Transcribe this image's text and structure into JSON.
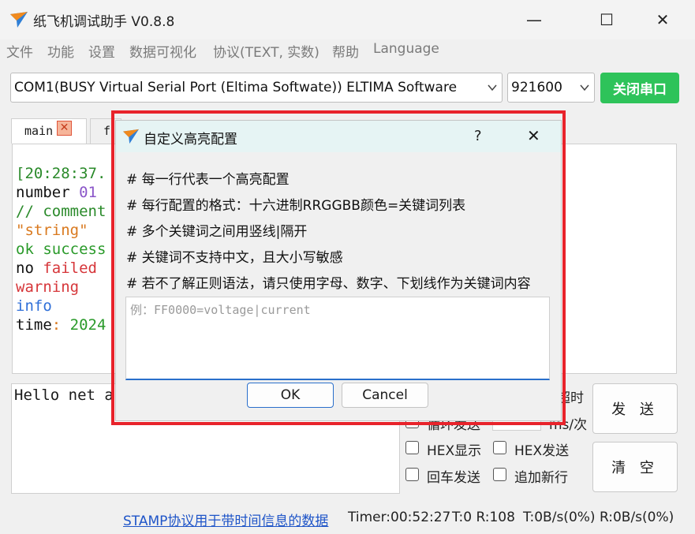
{
  "window": {
    "title": "纸飞机调试助手 V0.8.8",
    "minimize": "—",
    "maximize": "☐",
    "close": "✕"
  },
  "menu": [
    "文件",
    "功能",
    "设置",
    "数据可视化",
    "协议(TEXT, 实数)",
    "帮助",
    "Language"
  ],
  "port": {
    "selected": "COM1(BUSY  Virtual Serial Port (Eltima Softwate)) ELTIMA Software",
    "baud": "921600",
    "toggle_label": "关闭串口"
  },
  "tabs": [
    {
      "label": "main",
      "close": "✕"
    },
    {
      "label": "f"
    }
  ],
  "log": [
    {
      "text": "[20:28:37.",
      "color": "#2a8a2a"
    },
    {
      "parts": [
        {
          "text": "number ",
          "color": "#111111"
        },
        {
          "text": "01",
          "color": "#8a55c8"
        }
      ]
    },
    {
      "text": "// comment",
      "color": "#2a8a2a"
    },
    {
      "text": "\"string\"",
      "color": "#d9791e"
    },
    {
      "text": "ok success",
      "color": "#2a9a2a"
    },
    {
      "parts": [
        {
          "text": "no ",
          "color": "#111111"
        },
        {
          "text": "failed",
          "color": "#d6363a"
        }
      ]
    },
    {
      "text": "warning",
      "color": "#d6363a"
    },
    {
      "text": "info",
      "color": "#2f6fd8"
    },
    {
      "parts": [
        {
          "text": "time",
          "color": "#111111"
        },
        {
          "text": ": ",
          "color": "#d9791e"
        },
        {
          "text": "2024",
          "color": "#2a9a2a"
        }
      ]
    }
  ],
  "send_input": {
    "value": "Hello net a"
  },
  "right_panel": {
    "timeout_fragment": "超时",
    "interval_fragment": "ms/次",
    "loop_fragment": "循环发送",
    "checkboxes": [
      {
        "label": "HEX显示",
        "checked": false
      },
      {
        "label": "HEX发送",
        "checked": false
      },
      {
        "label": "回车发送",
        "checked": false
      },
      {
        "label": "追加新行",
        "checked": false
      }
    ],
    "send_button": "发 送",
    "clear_button": "清 空"
  },
  "status": {
    "link": "STAMP协议用于带时间信息的数据",
    "timer": "Timer:00:52:27",
    "counters": "T:0 R:108",
    "rates": "T:0B/s(0%) R:0B/s(0%)"
  },
  "dialog": {
    "title": "自定义高亮配置",
    "help": "?",
    "close": "✕",
    "hints": [
      "# 每一行代表一个高亮配置",
      "# 每行配置的格式：十六进制RRGGBB颜色=关键词列表",
      "# 多个关键词之间用竖线|隔开",
      "# 关键词不支持中文，且大小写敏感",
      "# 若不了解正则语法，请只使用字母、数字、下划线作为关键词内容"
    ],
    "editor_placeholder": "例：FF0000=voltage|current",
    "ok": "OK",
    "cancel": "Cancel"
  },
  "colors": {
    "accent_green": "#2ec35a",
    "highlight_border": "#e8232b",
    "dialog_title_bg": "#e6f4f4"
  }
}
